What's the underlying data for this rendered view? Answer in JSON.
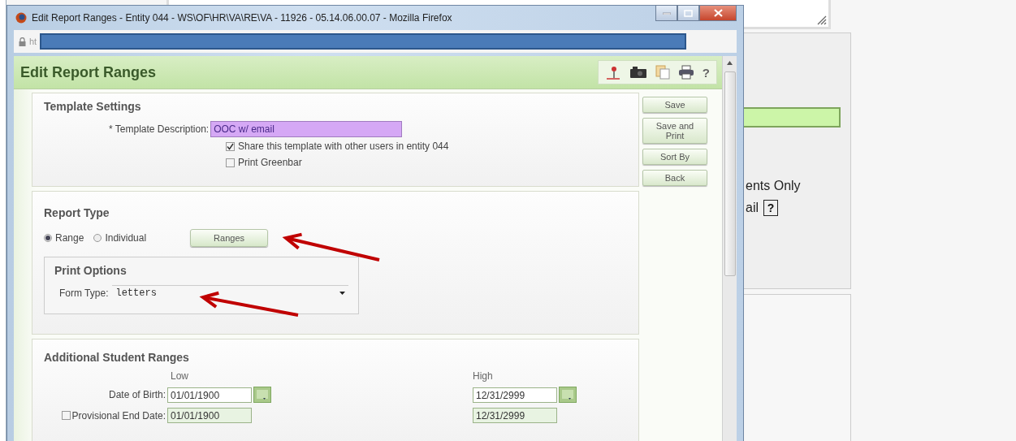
{
  "background_page": {
    "option_1": "ents Only",
    "option_2": "ail",
    "help_button": "?"
  },
  "window": {
    "title": "Edit Report Ranges - Entity 044 - WS\\OF\\HR\\VA\\RE\\VA - 11926 - 05.14.06.00.07 - Mozilla Firefox",
    "address_prefix": "ht"
  },
  "page_title": "Edit Report Ranges",
  "toolbar_help": "?",
  "side_buttons": [
    "Save",
    "Save and Print",
    "Sort By",
    "Back"
  ],
  "template_settings": {
    "heading": "Template Settings",
    "description_label": "* Template Description:",
    "description_value": "OOC w/ email",
    "options": [
      {
        "label": "Share this template with other users in entity 044",
        "checked": true
      },
      {
        "label": "Print Greenbar",
        "checked": false
      }
    ]
  },
  "report_type": {
    "heading": "Report Type",
    "choices": [
      {
        "label": "Range",
        "selected": true
      },
      {
        "label": "Individual",
        "selected": false
      }
    ],
    "ranges_button": "Ranges",
    "print_options": {
      "heading": "Print Options",
      "form_type_label": "Form Type:",
      "form_type_value": "letters"
    }
  },
  "additional_ranges": {
    "heading": "Additional Student Ranges",
    "low_header": "Low",
    "high_header": "High",
    "rows": [
      {
        "kind": "date-picker",
        "label": "Date of Birth:",
        "low": "01/01/1900",
        "high": "12/31/2999"
      },
      {
        "kind": "checkbox",
        "checked": false,
        "label": "Provisional End Date:",
        "low": "01/01/1900",
        "high": "12/31/2999"
      }
    ]
  }
}
